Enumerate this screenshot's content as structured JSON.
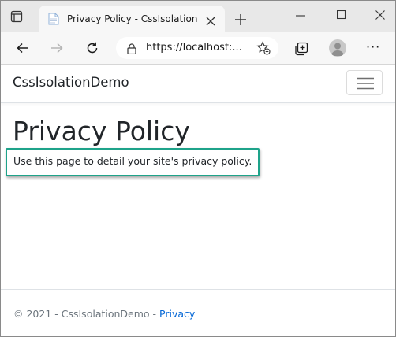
{
  "browser": {
    "tab": {
      "title": "Privacy Policy - CssIsolationDemo"
    },
    "address_bar": {
      "url": "https://localhost:..."
    },
    "icons": {
      "tab_actions": "tab-actions-icon",
      "favicon": "page-favicon",
      "close_tab": "close-icon",
      "new_tab": "plus-icon",
      "minimize": "minimize-icon",
      "maximize": "maximize-icon",
      "close_window": "close-icon",
      "back": "arrow-left-icon",
      "forward": "arrow-right-icon",
      "refresh": "refresh-icon",
      "site_info": "lock-icon",
      "add_favorite": "star-plus-icon",
      "collections": "collections-icon",
      "profile": "profile-avatar",
      "settings_more": "ellipsis-icon"
    },
    "more_label": "···"
  },
  "site": {
    "brand": "CssIsolationDemo",
    "menu_icon": "hamburger-icon",
    "page_title": "Privacy Policy",
    "body_text": "Use this page to detail your site's privacy policy.",
    "footer": {
      "copyright": "© 2021 - CssIsolationDemo - ",
      "link_text": "Privacy"
    }
  },
  "colors": {
    "highlight_border": "#1ea38a",
    "link": "#0366d6",
    "footer_text": "#6c757d",
    "body_text": "#212529"
  }
}
